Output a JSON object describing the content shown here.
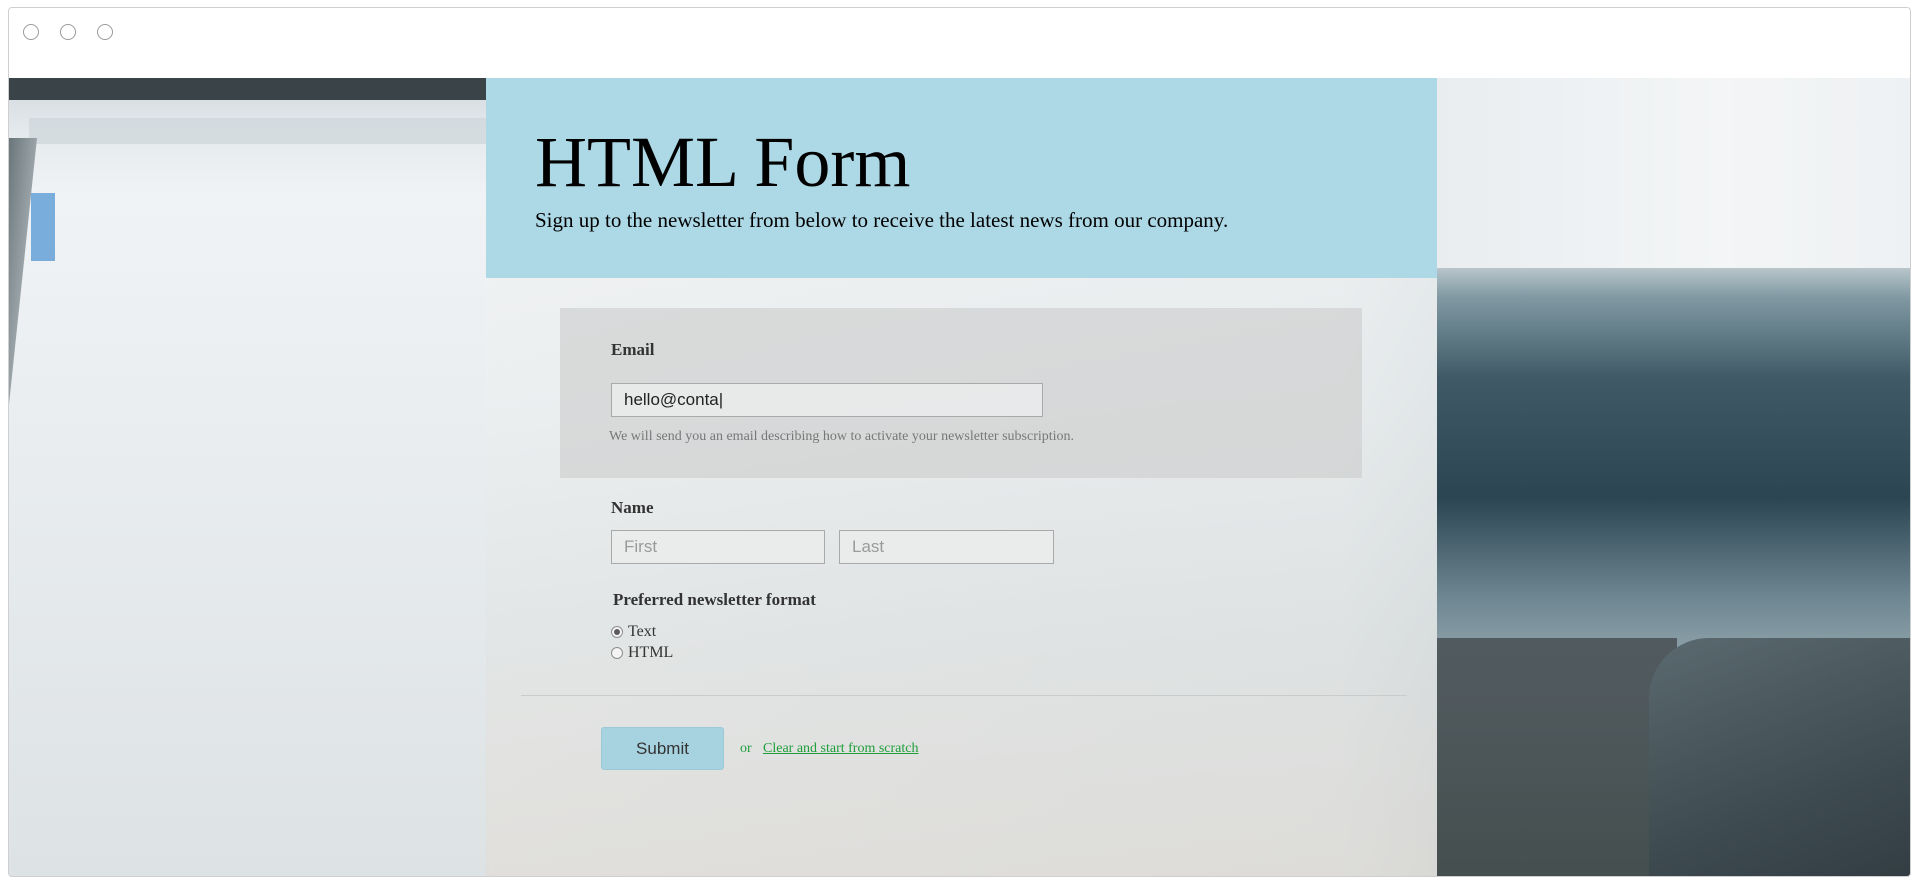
{
  "window": {
    "controls": [
      "close",
      "minimize",
      "maximize"
    ]
  },
  "header": {
    "title": "HTML Form",
    "subtitle": "Sign up to the newsletter from below to receive the latest news from our company."
  },
  "form": {
    "email": {
      "label": "Email",
      "value": "hello@conta|",
      "help": "We will send you an email describing how to activate your newsletter subscription."
    },
    "name": {
      "label": "Name",
      "first_placeholder": "First",
      "last_placeholder": "Last"
    },
    "format": {
      "label": "Preferred newsletter format",
      "options": [
        {
          "label": "Text",
          "checked": true
        },
        {
          "label": "HTML",
          "checked": false
        }
      ]
    },
    "actions": {
      "submit_label": "Submit",
      "or_text": "or",
      "clear_label": "Clear and start from scratch"
    }
  },
  "colors": {
    "hero_bg": "#add8e6",
    "link": "#1e9e3b",
    "submit_bg": "#a7d3e0"
  }
}
